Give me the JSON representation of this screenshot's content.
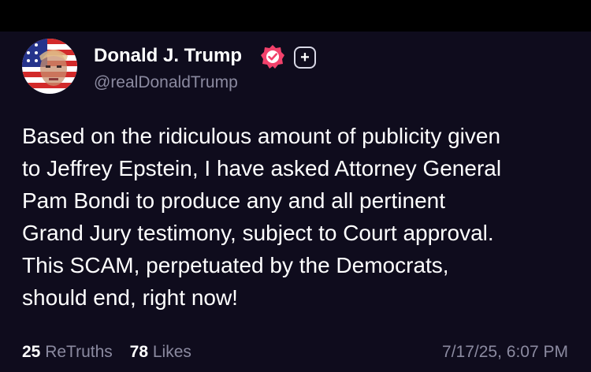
{
  "author": {
    "name": "Donald J. Trump",
    "handle": "@realDonaldTrump",
    "verified_icon": "verified-badge-icon",
    "add_icon": "plus-icon",
    "add_symbol": "+"
  },
  "post": {
    "lines": [
      "Based on the ridiculous amount of publicity given",
      "to Jeffrey Epstein, I have asked Attorney General",
      "Pam Bondi to produce any and all pertinent",
      "Grand Jury testimony, subject to Court approval.",
      "This SCAM, perpetuated by the Democrats,",
      "should end, right now!"
    ]
  },
  "stats": {
    "retruths_count": "25",
    "retruths_label": "ReTruths",
    "likes_count": "78",
    "likes_label": "Likes"
  },
  "timestamp": "7/17/25, 6:07 PM",
  "colors": {
    "background": "#0f0c1d",
    "muted_text": "#8b8aa0",
    "verified_badge": "#f2416b"
  }
}
